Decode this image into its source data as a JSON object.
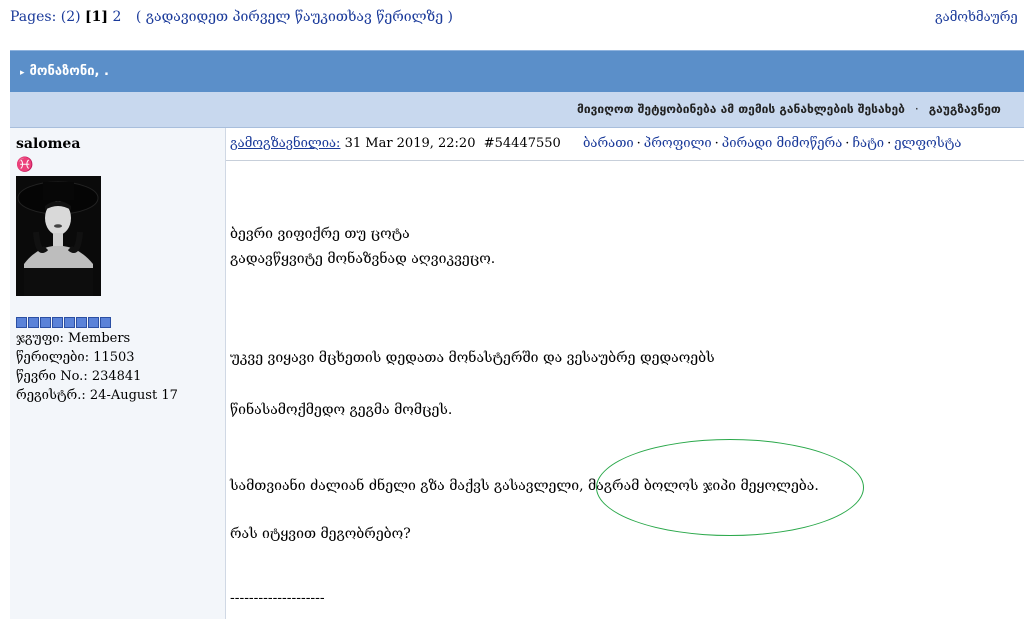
{
  "top": {
    "pages_label": "Pages: (2)",
    "current_page": "[1]",
    "next_page": "2",
    "jump_link": "( გადავიდეთ პირველ წაუკითხავ წერილზე )",
    "right_link": "გამოხმაურე"
  },
  "topic": {
    "title": "მონაზონი, ."
  },
  "options": {
    "subscribe": "მივიღოთ შეტყობინება ამ თემის განახლების შესახებ",
    "forward": "გაუგზავნეთ"
  },
  "user": {
    "name": "salomea",
    "zodiac_symbol": "♓",
    "group_label": "ჯგუფი: Members",
    "posts_label": "წერილები: 11503",
    "member_no_label": "წევრი No.: 234841",
    "registered_label": "რეგისტრ.: 24-August 17"
  },
  "post": {
    "sent_label": "გამოგზავნილია:",
    "sent_date": "31 Mar 2019, 22:20",
    "post_id": "#54447550",
    "links": [
      "ბარათი",
      "პროფილი",
      "პირადი მიმოწერა",
      "ჩატი",
      "ელფოსტა"
    ],
    "lines": [
      "ბევრი ვიფიქრე თუ ცოტა",
      "გადავწყვიტე მონაზვნად აღვიკვეცო.",
      "უკვე ვიყავი მცხეთის დედათა მონასტერში და ვესაუბრე დედაოებს",
      "წინასამოქმედო გეგმა მომცეს.",
      "სამთვიანი ძალიან ძნელი გზა მაქვს გასავლელი, მაგრამ ბოლოს ჯიპი მეყოლება.",
      "რას იტყვით მეგობრებო?",
      "--------------------"
    ]
  }
}
